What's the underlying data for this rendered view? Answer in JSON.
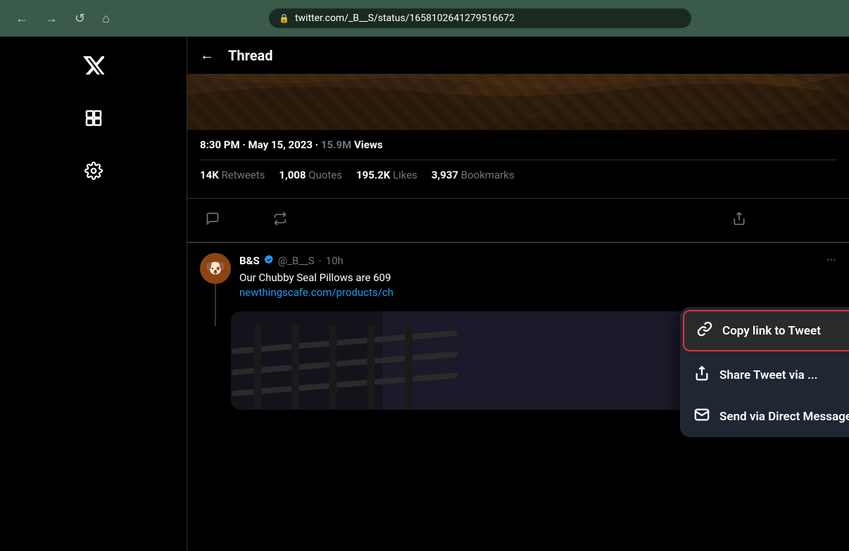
{
  "browser": {
    "url": "twitter.com/_B__S/status/1658102641279516672",
    "back_label": "←",
    "forward_label": "→",
    "reload_label": "↺",
    "home_label": "⌂",
    "lock_icon": "🔒"
  },
  "sidebar": {
    "twitter_bird": "🐦",
    "hashtag_icon": "#",
    "settings_icon": "⚙"
  },
  "header": {
    "back_arrow": "←",
    "title": "Thread"
  },
  "tweet": {
    "time": "8:30 PM · May 15, 2023 · ",
    "views_count": "15.9M",
    "views_label": " Views",
    "stats": [
      {
        "value": "14K",
        "label": " Retweets"
      },
      {
        "value": "1,008",
        "label": " Quotes"
      },
      {
        "value": "195.2K",
        "label": " Likes"
      },
      {
        "value": "3,937",
        "label": " Bookmarks"
      }
    ]
  },
  "reply": {
    "author": "B&S",
    "verified": true,
    "handle": "@_B__S",
    "time_ago": "10h",
    "text": "Our Chubby Seal Pillows are 609",
    "link": "newthingscafe.com/products/ch",
    "avatar_emoji": "🐶",
    "more_dots": "···"
  },
  "context_menu": {
    "items": [
      {
        "id": "copy-link",
        "icon": "🔗",
        "label": "Copy link to Tweet",
        "highlighted": true
      },
      {
        "id": "share-tweet",
        "icon": "↑",
        "label": "Share Tweet via ...",
        "highlighted": false
      },
      {
        "id": "send-dm",
        "icon": "✉",
        "label": "Send via Direct Message",
        "highlighted": false
      }
    ]
  },
  "actions": {
    "reply_icon": "💬",
    "retweet_icon": "🔁",
    "share_icon": "↑"
  }
}
